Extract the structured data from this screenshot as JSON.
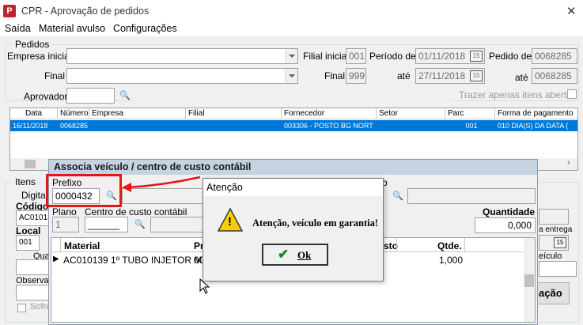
{
  "window": {
    "title": "CPR - Aprovação de pedidos",
    "close_glyph": "✕"
  },
  "menu": {
    "items": [
      "Saída",
      "Material avulso",
      "Configurações"
    ]
  },
  "pedidos": {
    "group_title": "Pedidos",
    "empresa_inicial_label": "Empresa inicial",
    "final_label": "Final",
    "aprovador_label": "Aprovador",
    "filial_inicial_label": "Filial inicial",
    "filial_inicial_value": "001",
    "filial_final_label": "Final",
    "filial_final_value": "999",
    "periodo_de_label": "Período de",
    "periodo_de_value": "01/11/2018",
    "ate_label": "até",
    "ate_value": "27/11/2018",
    "pedido_de_label": "Pedido de",
    "pedido_de_value": "0068285",
    "pedido_ate_label": "até",
    "pedido_ate_value": "0068285",
    "trazer_label": "Trazer apenas itens abertos",
    "calendar_glyph": "15"
  },
  "grid": {
    "headers": [
      "Data",
      "Número",
      "Empresa",
      "Filial",
      "Fornecedor",
      "Setor",
      "Parc",
      "Forma de pagamento"
    ],
    "row": [
      "16/11/2018",
      "0068285",
      "",
      "",
      "003306 - POSTO BG NORT",
      "",
      "001",
      "010 DIA(S) DA DATA  ("
    ]
  },
  "itens": {
    "group_title": "Itens",
    "digitacao_label": "Digitaç",
    "codigo_label": "Código",
    "codigo_value": "AC01013",
    "local_label": "Local",
    "local_value": "001",
    "qua_label": "Qua",
    "observacao_label": "Observaç",
    "sofre_label": "Sofre",
    "prazo_label": "a entrega",
    "prazo_cal": "15",
    "veiculo_label": "eículo",
    "acao_label": "ação"
  },
  "associa": {
    "title": "Associa veículo / centro de custo contábil",
    "prefixo_label": "Prefixo",
    "prefixo_value": "0000432",
    "plano_label": "Plano",
    "plano_value": "1",
    "centro_label": "Centro de custo contábil",
    "centro_value": "______",
    "quantidade_label": "Quantidade",
    "quantidade_value": "0,000",
    "table_headers": [
      "Material",
      "Pr",
      "sto",
      "Qtde."
    ],
    "table_row": [
      "AC010139 1º TUBO INJETOR ME",
      "00",
      "",
      "1,000"
    ],
    "o_label": "o"
  },
  "alert": {
    "title": "Atenção",
    "message": "Atenção, veículo em garantia!",
    "ok_label": "Ok",
    "warning_glyph": "!"
  },
  "colors": {
    "selection": "#0078d7",
    "highlight_border": "#e8141b",
    "dialog_title_bg": "#c5d3e0",
    "app_icon": "#c0222e"
  }
}
